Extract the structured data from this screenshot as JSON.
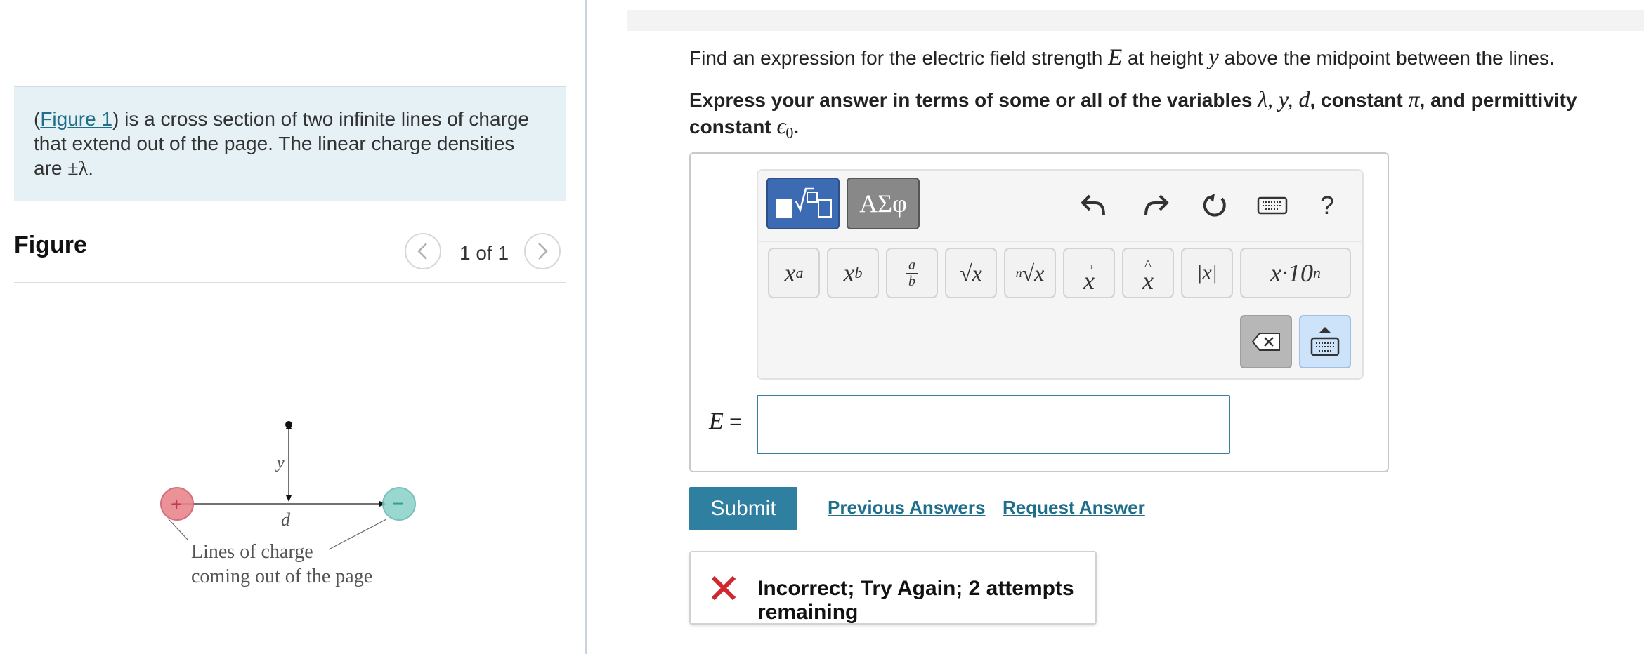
{
  "intro": {
    "prefix": "(",
    "figure_link": "Figure 1",
    "text_line1_rest": ") is a cross section of two infinite lines of charge",
    "text_line2": "that extend out of the page. The linear charge densities",
    "text_line3_prefix": "are ",
    "text_line3_symbol": "±λ",
    "text_line3_suffix": "."
  },
  "figure": {
    "title": "Figure",
    "page_indicator": "1 of 1",
    "prev_icon": "chevron-left-icon",
    "next_icon": "chevron-right-icon",
    "labels": {
      "y": "y",
      "d": "d",
      "plus": "+",
      "minus": "−",
      "caption_line1": "Lines of charge",
      "caption_line2": "coming out of the page"
    },
    "colors": {
      "positive": "#e9878f",
      "negative": "#8fd3cc"
    }
  },
  "question": {
    "text_before": "Find an expression for the electric field strength ",
    "var_E": "E",
    "text_middle": " at height ",
    "var_y": "y",
    "text_after": " above the midpoint between the lines."
  },
  "instructions": {
    "text1": "Express your answer in terms of some or all of the variables ",
    "vars": "λ, y, d",
    "text2": ", constant ",
    "pi": "π",
    "text3": ", and permittivity constant ",
    "eps": "ϵ",
    "eps_sub": "0",
    "text4": "."
  },
  "toolbar": {
    "greek_tab": "ΑΣφ",
    "help": "?",
    "keys": {
      "power": "x",
      "power_sup": "a",
      "subscript": "x",
      "subscript_sub": "b",
      "frac_num": "a",
      "frac_den": "b",
      "sqrt": "√x",
      "nroot_index": "n",
      "nroot": "√x",
      "vector": "x",
      "unit_vector": "x",
      "abs": "|x|",
      "sci": "x·10",
      "sci_sup": "n"
    }
  },
  "answer": {
    "label_var": "E",
    "label_eq": " =",
    "value": ""
  },
  "actions": {
    "submit": "Submit",
    "previous_answers": "Previous Answers",
    "request_answer": "Request Answer"
  },
  "feedback": {
    "icon": "x-mark-icon",
    "text": "Incorrect; Try Again; 2 attempts remaining",
    "color": "#d0282e"
  },
  "colors": {
    "accent": "#2f7fa0",
    "intro_bg": "#e5f1f4",
    "templates_tab": "#3d6bb3",
    "keyboard_toggle": "#cde3fa"
  }
}
